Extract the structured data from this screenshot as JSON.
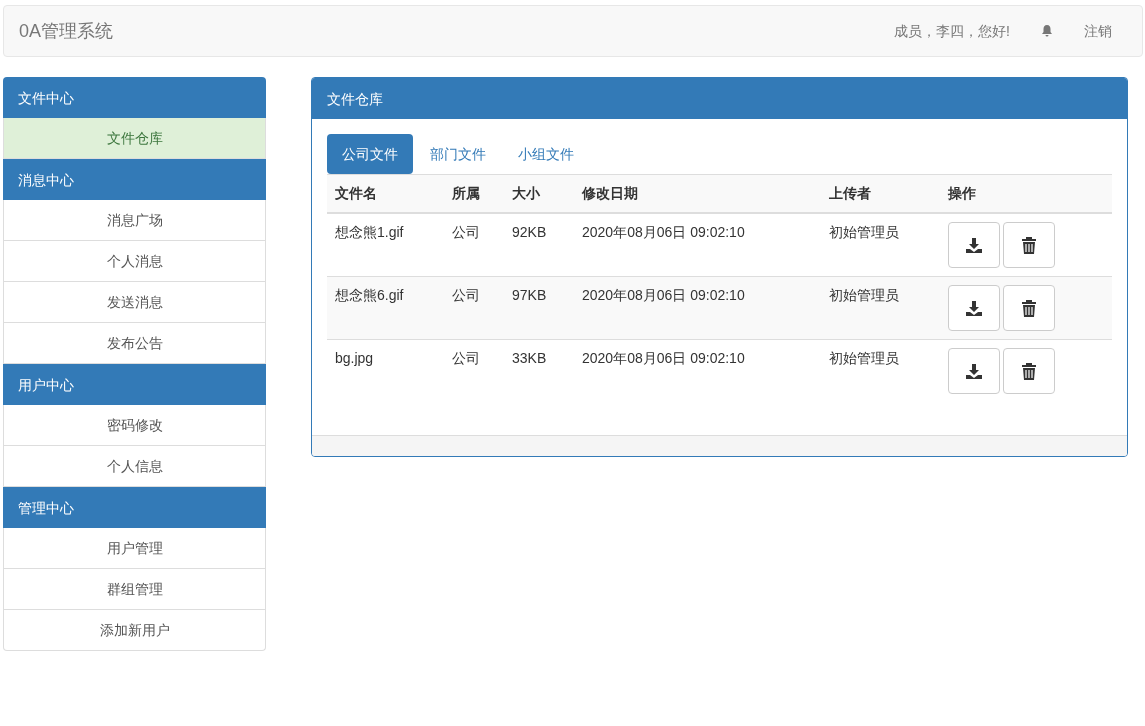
{
  "navbar": {
    "brand": "0A管理系统",
    "greeting": "成员，李四，您好!",
    "logout": "注销"
  },
  "sidebar": {
    "groups": [
      {
        "title": "文件中心",
        "items": [
          {
            "label": "文件仓库",
            "selected": true
          }
        ]
      },
      {
        "title": "消息中心",
        "items": [
          {
            "label": "消息广场",
            "selected": false
          },
          {
            "label": "个人消息",
            "selected": false
          },
          {
            "label": "发送消息",
            "selected": false
          },
          {
            "label": "发布公告",
            "selected": false
          }
        ]
      },
      {
        "title": "用户中心",
        "items": [
          {
            "label": "密码修改",
            "selected": false
          },
          {
            "label": "个人信息",
            "selected": false
          }
        ]
      },
      {
        "title": "管理中心",
        "items": [
          {
            "label": "用户管理",
            "selected": false
          },
          {
            "label": "群组管理",
            "selected": false
          },
          {
            "label": "添加新用户",
            "selected": false
          }
        ]
      }
    ]
  },
  "panel": {
    "title": "文件仓库",
    "tabs": [
      {
        "label": "公司文件",
        "selected": true
      },
      {
        "label": "部门文件",
        "selected": false
      },
      {
        "label": "小组文件",
        "selected": false
      }
    ],
    "table": {
      "columns": [
        "文件名",
        "所属",
        "大小",
        "修改日期",
        "上传者",
        "操作"
      ],
      "rows": [
        {
          "name": "想念熊1.gif",
          "owner": "公司",
          "size": "92KB",
          "modified": "2020年08月06日 09:02:10",
          "uploader": "初始管理员"
        },
        {
          "name": "想念熊6.gif",
          "owner": "公司",
          "size": "97KB",
          "modified": "2020年08月06日 09:02:10",
          "uploader": "初始管理员"
        },
        {
          "name": "bg.jpg",
          "owner": "公司",
          "size": "33KB",
          "modified": "2020年08月06日 09:02:10",
          "uploader": "初始管理员"
        }
      ]
    }
  }
}
